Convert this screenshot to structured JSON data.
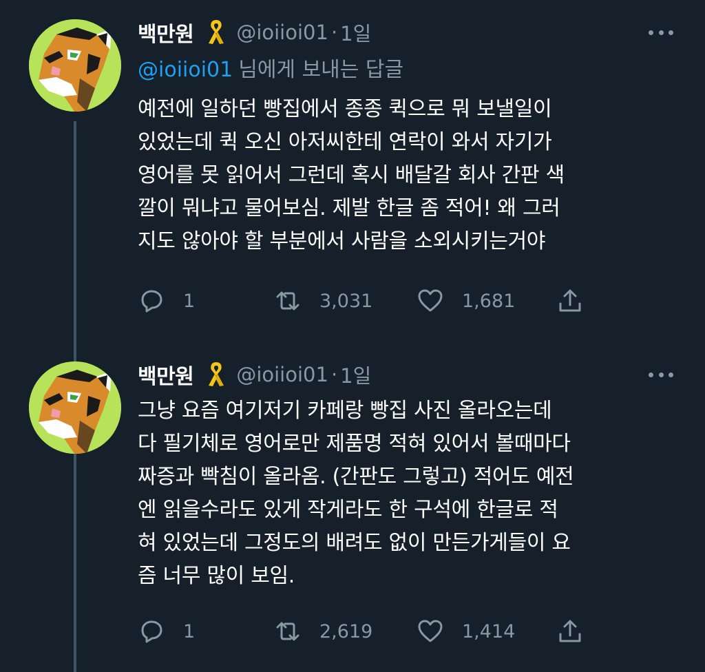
{
  "tweets": [
    {
      "author": {
        "display_name": "백만원",
        "handle": "@ioiioi01",
        "badge": "yellow-ribbon-icon"
      },
      "separator": "·",
      "time": "1일",
      "reply_to": {
        "handle": "@ioiioi01",
        "suffix": "님에게 보내는 답글"
      },
      "text": "예전에 일하던 빵집에서 종종 퀵으로 뭐 보낼일이\n있었는데 퀵 오신 아저씨한테 연락이 와서 자기가\n영어를 못 읽어서 그런데 혹시 배달갈 회사 간판 색\n깔이 뭐냐고 물어보심. 제발 한글 좀 적어! 왜 그러\n지도 않아야 할 부분에서 사람을 소외시키는거야",
      "stats": {
        "replies": "1",
        "retweets": "3,031",
        "likes": "1,681"
      }
    },
    {
      "author": {
        "display_name": "백만원",
        "handle": "@ioiioi01",
        "badge": "yellow-ribbon-icon"
      },
      "separator": "·",
      "time": "1일",
      "text": "그냥 요즘 여기저기 카페랑 빵집 사진 올라오는데\n다 필기체로 영어로만 제품명 적혀 있어서 볼때마다\n짜증과 빡침이 올라옴. (간판도 그렇고) 적어도 예전\n엔 읽을수라도 있게 작게라도 한 구석에 한글로 적\n혀 있었는데 그정도의 배려도 없이 만든가게들이 요\n즘 너무 많이 보임.",
      "stats": {
        "replies": "1",
        "retweets": "2,619",
        "likes": "1,414"
      }
    }
  ],
  "colors": {
    "background": "#15202b",
    "text_primary": "#ffffff",
    "text_secondary": "#8899a6",
    "link": "#1da1f2",
    "thread_line": "#3d5466",
    "ribbon": "#f5c518",
    "avatar_bg": "#b7e35a"
  },
  "icons": {
    "reply": "speech-bubble-icon",
    "retweet": "retweet-arrows-icon",
    "like": "heart-icon",
    "share": "share-upload-icon",
    "more": "more-dots-icon"
  }
}
